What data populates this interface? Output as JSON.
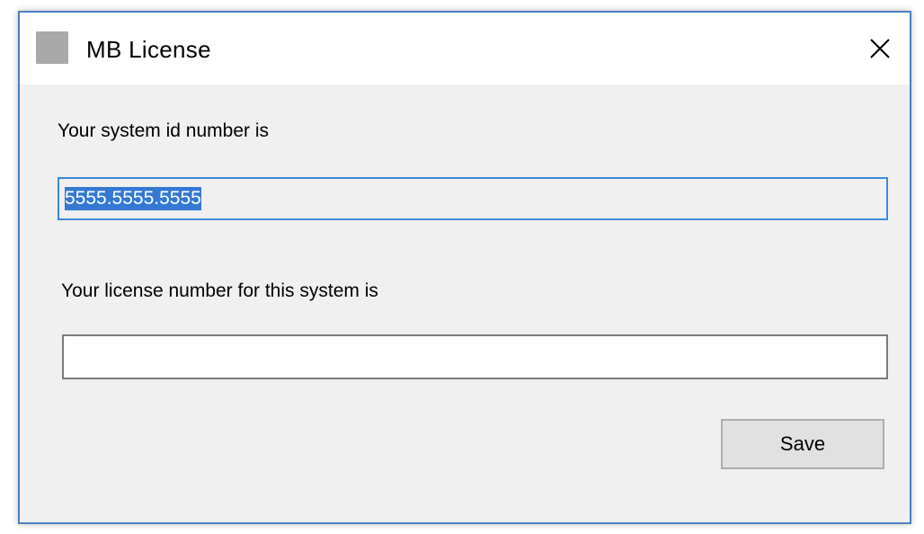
{
  "window": {
    "title": "MB License",
    "app_icon": "app-icon-gray-square",
    "close_icon": "close-icon"
  },
  "content": {
    "system_id_label": "Your system id number is",
    "system_id_value": "5555.5555.5555",
    "license_label": "Your license number for this system is",
    "license_value": ""
  },
  "actions": {
    "save_label": "Save"
  },
  "colors": {
    "window_border": "#4a7fbf",
    "body_background": "#f0f0f0",
    "titlebar_background": "#ffffff",
    "selection_highlight": "#3478d4",
    "focus_border": "#3c8ad8"
  }
}
